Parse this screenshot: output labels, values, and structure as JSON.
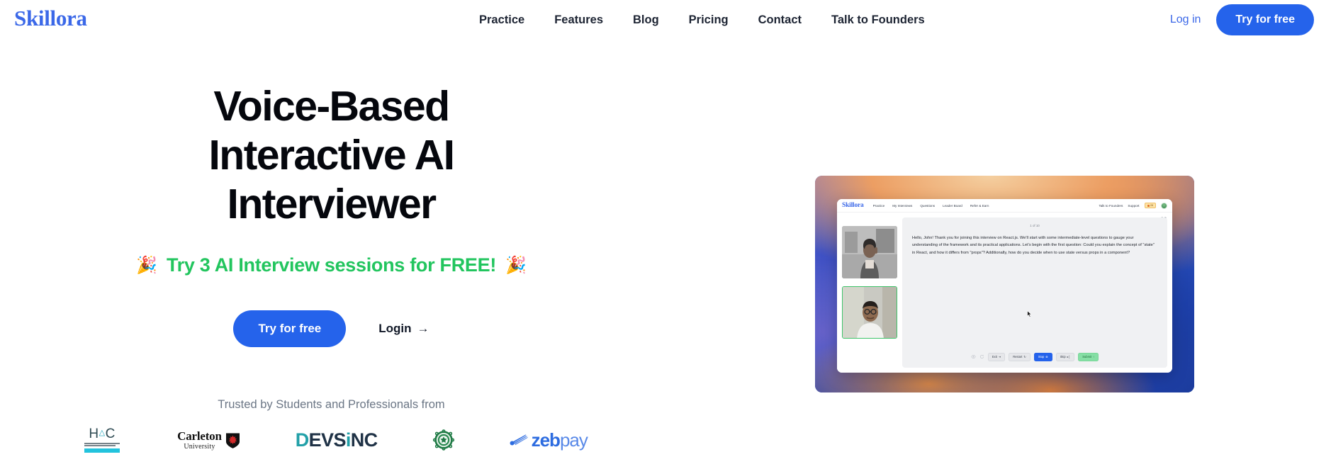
{
  "brand": {
    "name": "Skillora",
    "color": "#3b68e8"
  },
  "topnav": {
    "links": [
      {
        "label": "Practice"
      },
      {
        "label": "Features"
      },
      {
        "label": "Blog"
      },
      {
        "label": "Pricing"
      },
      {
        "label": "Contact"
      },
      {
        "label": "Talk to Founders"
      }
    ],
    "login_label": "Log in",
    "cta_label": "Try for free",
    "cta_color": "#2563eb"
  },
  "hero": {
    "title_line1": "Voice-Based",
    "title_line2": "Interactive AI",
    "title_line3": "Interviewer",
    "subtitle": "Try 3 AI Interview sessions for FREE!",
    "subtitle_color": "#22c55e",
    "emoji_left": "🎉",
    "emoji_right": "🎉",
    "cta_label": "Try for free",
    "login_label": "Login",
    "login_arrow": "→",
    "trusted_label": "Trusted by Students and Professionals from",
    "brands": [
      {
        "name": "HAC",
        "mark": "HAC",
        "accent": "#22c3dd"
      },
      {
        "name": "Carleton University",
        "line1": "Carleton",
        "line2": "University"
      },
      {
        "name": "Devsinc",
        "part1": "D",
        "part2": "EVS",
        "part3": "i",
        "part4": "NC"
      },
      {
        "name": "University Seal",
        "mark": "green-seal"
      },
      {
        "name": "ZebPay",
        "part1": "zeb",
        "part2": "pay"
      }
    ]
  },
  "product_shot": {
    "app": {
      "logo": "Skillora",
      "nav_links": [
        {
          "label": "Practice"
        },
        {
          "label": "My Interviews"
        },
        {
          "label": "Questions"
        },
        {
          "label": "Leader Board"
        },
        {
          "label": "Refer & Earn"
        }
      ],
      "nav_right": [
        {
          "label": "Talk to Founders"
        },
        {
          "label": "Support"
        }
      ],
      "credits_badge": "28",
      "question_counter": "1 of 10",
      "question_text": "Hello, John! Thank you for joining this interview on React.js. We'll start with some intermediate-level questions to gauge your understanding of the framework and its practical applications. Let's begin with the first question: Could you explain the concept of \"state\" in React, and how it differs from \"props\"? Additionally, how do you decide when to use state versus props in a component?",
      "actions": [
        {
          "label": "Exit",
          "glyph": "⇥",
          "style": "default"
        },
        {
          "label": "Restart",
          "glyph": "↻",
          "style": "default"
        },
        {
          "label": "Stop",
          "glyph": "⊗",
          "style": "blue"
        },
        {
          "label": "Skip",
          "glyph": "▸│",
          "style": "default"
        },
        {
          "label": "Submit",
          "glyph": "↑",
          "style": "green"
        }
      ],
      "tiles": [
        {
          "name": "interviewer-video"
        },
        {
          "name": "candidate-video"
        }
      ]
    }
  }
}
